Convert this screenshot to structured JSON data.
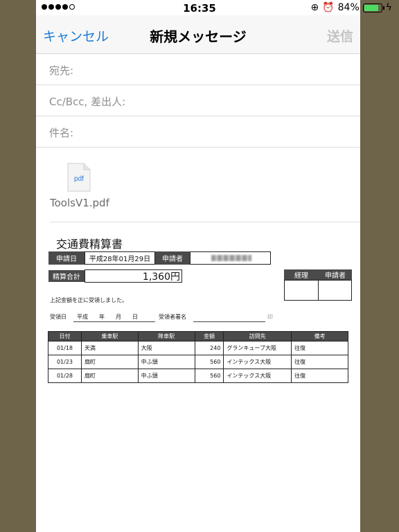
{
  "status": {
    "time": "16:35",
    "battery": "84%",
    "battery_level": 0.84
  },
  "nav": {
    "cancel": "キャンセル",
    "title": "新規メッセージ",
    "send": "送信"
  },
  "fields": {
    "to": "宛先:",
    "cc": "Cc/Bcc, 差出人:",
    "subject": "件名:"
  },
  "attachment": {
    "icon_label": "pdf",
    "name": "ToolsV1.pdf"
  },
  "doc": {
    "title": "交通費精算書",
    "apply_date_label": "申請日",
    "apply_date": "平成28年01月29日",
    "applicant_label": "申請者",
    "total_label": "精算合計",
    "total": "1,360円",
    "accounting": "経理",
    "applicant_stamp": "申請者",
    "received_text": "上記金額を正に受領しました。",
    "received_date_label": "受領日",
    "received_date": "平成　　年　　月　　日",
    "signature_label": "受領者署名",
    "seal": "印",
    "columns": [
      "日付",
      "乗車駅",
      "降車駅",
      "金額",
      "訪問先",
      "備考"
    ],
    "rows": [
      [
        "01/18",
        "天満",
        "大阪",
        "240",
        "グランキューブ大阪",
        "往復"
      ],
      [
        "01/23",
        "扇町",
        "中ふ頭",
        "560",
        "インテックス大阪",
        "往復"
      ],
      [
        "01/28",
        "扇町",
        "中ふ頭",
        "560",
        "インテックス大阪",
        "往復"
      ]
    ]
  }
}
